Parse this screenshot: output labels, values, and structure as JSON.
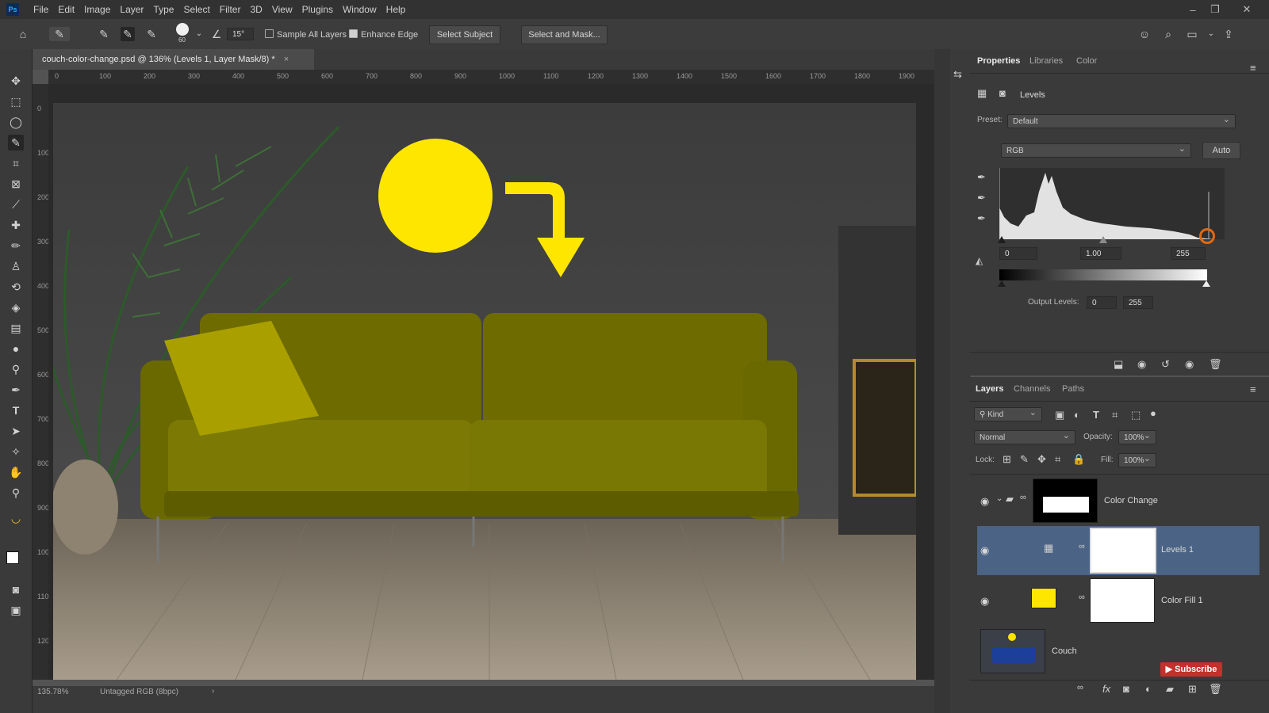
{
  "menubar": {
    "app_icon": "Ps",
    "items": [
      "File",
      "Edit",
      "Image",
      "Layer",
      "Type",
      "Select",
      "Filter",
      "3D",
      "View",
      "Plugins",
      "Window",
      "Help"
    ]
  },
  "options": {
    "brush_size": "60",
    "angle": "15°",
    "sample_all_layers": "Sample All Layers",
    "enhance_edge": "Enhance Edge",
    "select_subject": "Select Subject",
    "select_and_mask": "Select and Mask..."
  },
  "document": {
    "tab_title": "couch-color-change.psd @ 136% (Levels 1, Layer Mask/8) *",
    "ruler_h": [
      "0",
      "100",
      "200",
      "300",
      "400",
      "500",
      "600",
      "700",
      "800",
      "900",
      "1000",
      "1100",
      "1200",
      "1300",
      "1400",
      "1500",
      "1600",
      "1700",
      "1800",
      "1900"
    ],
    "ruler_v": [
      "0",
      "100",
      "200",
      "300",
      "400",
      "500",
      "600",
      "700",
      "800",
      "900",
      "1000",
      "1100",
      "1200"
    ],
    "zoom": "135.78%",
    "color_profile": "Untagged RGB (8bpc)"
  },
  "properties": {
    "tabs": [
      "Properties",
      "Libraries",
      "Color"
    ],
    "adjustment_name": "Levels",
    "preset_label": "Preset:",
    "preset_value": "Default",
    "channel": "RGB",
    "auto_button": "Auto",
    "input_black": "0",
    "input_gamma": "1.00",
    "input_white": "255",
    "output_label": "Output Levels:",
    "output_black": "0",
    "output_white": "255"
  },
  "layers_panel": {
    "tabs": [
      "Layers",
      "Channels",
      "Paths"
    ],
    "filter_kind": "Kind",
    "blend_mode": "Normal",
    "opacity_label": "Opacity:",
    "opacity_value": "100%",
    "lock_label": "Lock:",
    "fill_label": "Fill:",
    "fill_value": "100%",
    "layers": [
      {
        "name": "Color Change",
        "visible": true,
        "selected": false
      },
      {
        "name": "Levels 1",
        "visible": true,
        "selected": true
      },
      {
        "name": "Color Fill 1",
        "visible": true,
        "selected": false
      },
      {
        "name": "Couch",
        "visible": true,
        "selected": false
      }
    ]
  },
  "overlay": {
    "subscribe": "Subscribe"
  },
  "colors": {
    "accent_yellow": "#ffe600",
    "selected_layer": "#4b6384",
    "couch_olive": "#6b6a00"
  }
}
